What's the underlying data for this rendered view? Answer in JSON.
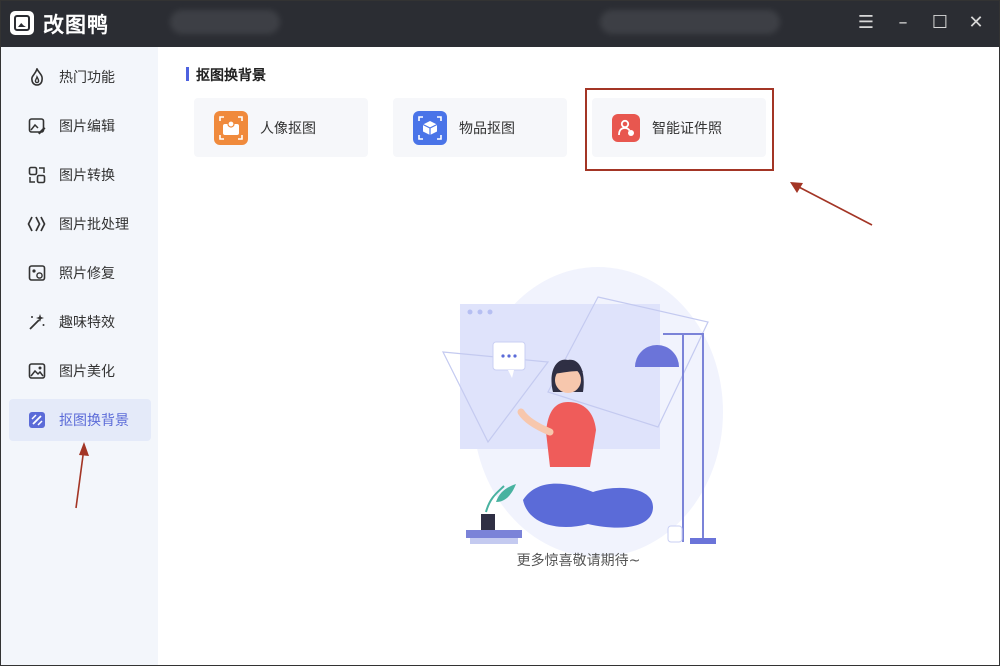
{
  "app": {
    "title": "改图鸭"
  },
  "window_controls": {
    "menu": "☰",
    "minimize": "–",
    "maximize": "☐",
    "close": "✕"
  },
  "sidebar": {
    "items": [
      {
        "label": "热门功能",
        "icon": "flame-icon"
      },
      {
        "label": "图片编辑",
        "icon": "image-edit-icon"
      },
      {
        "label": "图片转换",
        "icon": "convert-icon"
      },
      {
        "label": "图片批处理",
        "icon": "batch-icon"
      },
      {
        "label": "照片修复",
        "icon": "photo-repair-icon"
      },
      {
        "label": "趣味特效",
        "icon": "magic-wand-icon"
      },
      {
        "label": "图片美化",
        "icon": "beautify-icon"
      },
      {
        "label": "抠图换背景",
        "icon": "cutout-icon",
        "active": true
      }
    ]
  },
  "main": {
    "section_title": "抠图换背景",
    "features": [
      {
        "label": "人像抠图",
        "icon": "portrait-cutout-icon",
        "color": "#f08a3c"
      },
      {
        "label": "物品抠图",
        "icon": "object-cutout-icon",
        "color": "#4a74e8"
      },
      {
        "label": "智能证件照",
        "icon": "id-photo-icon",
        "color": "#e8574f"
      }
    ],
    "empty_text": "更多惊喜敬请期待~"
  },
  "colors": {
    "accent": "#4e62e0",
    "titlebar": "#2b2d33",
    "annotation": "#a33525"
  }
}
